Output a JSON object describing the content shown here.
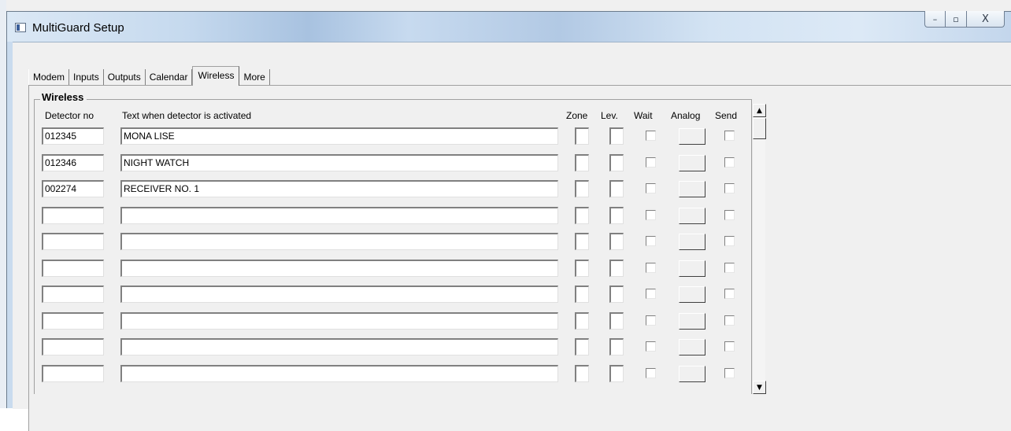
{
  "window": {
    "title": "MultiGuard Setup"
  },
  "caption": {
    "minimize_glyph": "–",
    "maximize_glyph": "▫",
    "close_glyph": "X"
  },
  "tabs": [
    {
      "label": "Modem"
    },
    {
      "label": "Inputs"
    },
    {
      "label": "Outputs"
    },
    {
      "label": "Calendar"
    },
    {
      "label": "Wireless",
      "active": true
    },
    {
      "label": "More"
    }
  ],
  "group": {
    "title": "Wireless"
  },
  "headers": {
    "detector": "Detector no",
    "text": "Text when detector is activated",
    "zone": "Zone",
    "lev": "Lev.",
    "wait": "Wait",
    "analog": "Analog",
    "send": "Send"
  },
  "rows": [
    {
      "detector": "012345",
      "text": "MONA LISE"
    },
    {
      "detector": "012346",
      "text": "NIGHT WATCH"
    },
    {
      "detector": "002274",
      "text": "RECEIVER NO. 1"
    },
    {
      "detector": "",
      "text": ""
    },
    {
      "detector": "",
      "text": ""
    },
    {
      "detector": "",
      "text": ""
    },
    {
      "detector": "",
      "text": ""
    },
    {
      "detector": "",
      "text": ""
    },
    {
      "detector": "",
      "text": ""
    },
    {
      "detector": "",
      "text": ""
    }
  ],
  "scrollbar": {
    "up_glyph": "▲",
    "down_glyph": "▼"
  }
}
